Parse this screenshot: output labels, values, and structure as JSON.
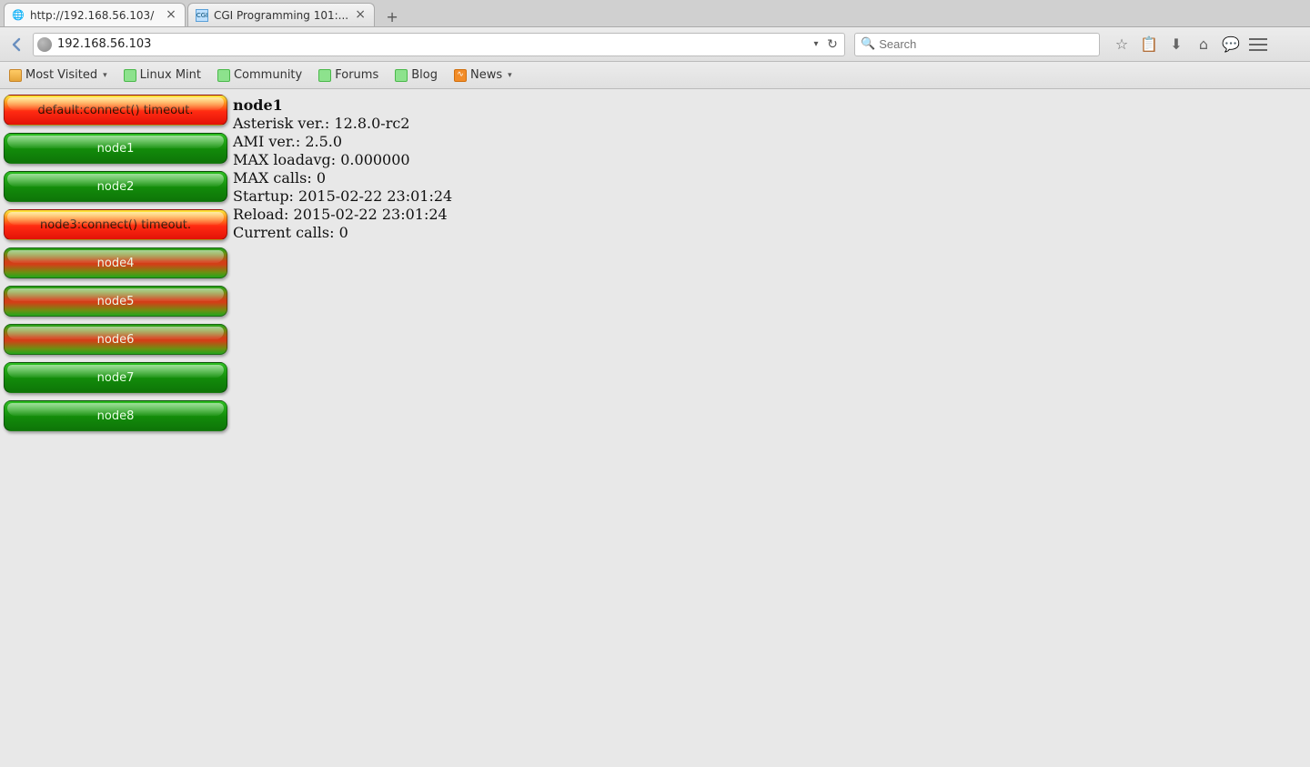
{
  "tabs": [
    {
      "title": "http://192.168.56.103/",
      "active": true
    },
    {
      "title": "CGI Programming 101:...",
      "active": false
    }
  ],
  "address": {
    "url": "192.168.56.103"
  },
  "search": {
    "placeholder": "Search"
  },
  "bookmarks": {
    "most_visited": "Most Visited",
    "linux_mint": "Linux Mint",
    "community": "Community",
    "forums": "Forums",
    "blog": "Blog",
    "news": "News"
  },
  "nodes": [
    {
      "label": "default:connect() timeout.",
      "style": "error"
    },
    {
      "label": "node1",
      "style": "green"
    },
    {
      "label": "node2",
      "style": "green"
    },
    {
      "label": "node3:connect() timeout.",
      "style": "error"
    },
    {
      "label": "node4",
      "style": "redgreen"
    },
    {
      "label": "node5",
      "style": "redgreen"
    },
    {
      "label": "node6",
      "style": "redgreen"
    },
    {
      "label": "node7",
      "style": "green"
    },
    {
      "label": "node8",
      "style": "green"
    }
  ],
  "detail": {
    "title": "node1",
    "asterisk_label": "Asterisk ver.: ",
    "asterisk_value": "12.8.0-rc2",
    "ami_label": "AMI ver.: ",
    "ami_value": "2.5.0",
    "loadavg_label": "MAX loadavg: ",
    "loadavg_value": "0.000000",
    "maxcalls_label": "MAX calls: ",
    "maxcalls_value": "0",
    "startup_label": "Startup: ",
    "startup_value": "2015-02-22 23:01:24",
    "reload_label": "Reload: ",
    "reload_value": "2015-02-22 23:01:24",
    "current_label": "Current calls: ",
    "current_value": "0"
  }
}
